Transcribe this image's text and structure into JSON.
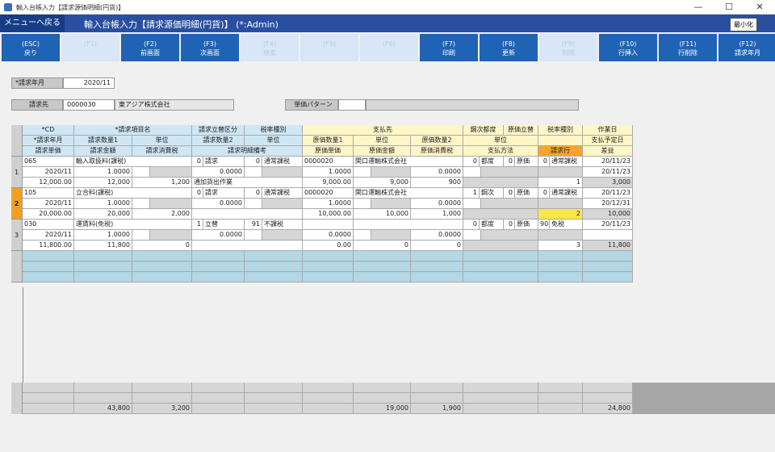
{
  "window": {
    "title": "輸入台帳入力【請求源価明細(円貨)】",
    "min": "—",
    "max": "☐",
    "close": "✕"
  },
  "header": {
    "back": "メニューへ戻る",
    "title": "輸入台帳入力【請求源価明細(円貨)】 (*:Admin)",
    "minimize": "最小化"
  },
  "fkeys": [
    {
      "key": "(ESC)",
      "label": "戻り",
      "enabled": true
    },
    {
      "key": "(F1)",
      "label": "",
      "enabled": false
    },
    {
      "key": "(F2)",
      "label": "前画面",
      "enabled": true
    },
    {
      "key": "(F3)",
      "label": "次画面",
      "enabled": true
    },
    {
      "key": "(F4)",
      "label": "検索",
      "enabled": false
    },
    {
      "key": "(F5)",
      "label": "",
      "enabled": false
    },
    {
      "key": "(F6)",
      "label": "",
      "enabled": false
    },
    {
      "key": "(F7)",
      "label": "印刷",
      "enabled": true
    },
    {
      "key": "(F8)",
      "label": "更新",
      "enabled": true
    },
    {
      "key": "(F9)",
      "label": "削除",
      "enabled": false
    },
    {
      "key": "(F10)",
      "label": "行挿入",
      "enabled": true
    },
    {
      "key": "(F11)",
      "label": "行削除",
      "enabled": true
    },
    {
      "key": "(F12)",
      "label": "請求年月",
      "enabled": true
    }
  ],
  "form": {
    "billing_month_label": "*請求年月",
    "billing_month": "2020/11",
    "customer_label": "請求先",
    "customer_code": "0000030",
    "customer_name": "東アジア株式会社",
    "price_pattern_label": "単価パターン",
    "price_pattern": ""
  },
  "grid_header": {
    "r1": [
      "*CD",
      "*請求項目名",
      "請求立替区分",
      "税率種別",
      "支払先",
      "鋼次都度",
      "原価立替",
      "税率種別",
      "作業日"
    ],
    "r2": [
      "*請求年月",
      "請求数量1",
      "単位",
      "請求数量2",
      "単位",
      "原価数量1",
      "単位",
      "原価数量2",
      "単位",
      "支払予定日"
    ],
    "r3": [
      "請求単価",
      "請求金額",
      "請求消費税",
      "請求明細備考",
      "原価単価",
      "原価金額",
      "原価消費税",
      "支払方法",
      "請求行",
      "差益"
    ]
  },
  "rows": [
    {
      "num": "1",
      "cd": "065",
      "item": "輸入取扱料(課税)",
      "rk": "0",
      "rk_t": "請求",
      "tax": "0",
      "tax_t": "通常課税",
      "payee": "0000020",
      "payee_name": "関口運輸株式会社",
      "tsudo": "0",
      "tsudo_t": "都度",
      "cost": "0",
      "cost_t": "原価",
      "tax2": "0",
      "tax2_t": "通常課税",
      "work": "20/11/23",
      "ym": "2020/11",
      "q1": "1.0000",
      "u1": "",
      "q2": "0.0000",
      "u2": "",
      "cq1": "1.0000",
      "cu1": "",
      "cq2": "0.0000",
      "cu2": "",
      "paydate": "20/11/23",
      "price": "12,000.00",
      "amount": "12,000",
      "ctax": "1,200",
      "memo": "通加貨出作業",
      "cprice": "9,000.00",
      "camount": "9,000",
      "cctax": "900",
      "paymethod": "",
      "line": "1",
      "profit": "3,000"
    },
    {
      "num": "2",
      "cd": "105",
      "item": "立合料(課税)",
      "rk": "0",
      "rk_t": "請求",
      "tax": "0",
      "tax_t": "通常課税",
      "payee": "0000020",
      "payee_name": "関口運輸株式会社",
      "tsudo": "1",
      "tsudo_t": "鋼次",
      "cost": "0",
      "cost_t": "原価",
      "tax2": "0",
      "tax2_t": "通常課税",
      "work": "20/11/23",
      "ym": "2020/11",
      "q1": "1.0000",
      "u1": "",
      "q2": "0.0000",
      "u2": "",
      "cq1": "1.0000",
      "cu1": "",
      "cq2": "0.0000",
      "cu2": "",
      "paydate": "20/12/31",
      "price": "20,000.00",
      "amount": "20,000",
      "ctax": "2,000",
      "memo": "",
      "cprice": "10,000.00",
      "camount": "10,000",
      "cctax": "1,000",
      "paymethod": "",
      "line": "2",
      "profit": "10,000"
    },
    {
      "num": "3",
      "cd": "030",
      "item": "運賃料(免税)",
      "rk": "1",
      "rk_t": "立替",
      "tax": "91",
      "tax_t": "不課税",
      "payee": "",
      "payee_name": "",
      "tsudo": "0",
      "tsudo_t": "都度",
      "cost": "0",
      "cost_t": "原価",
      "tax2": "90",
      "tax2_t": "免税",
      "work": "20/11/23",
      "ym": "2020/11",
      "q1": "1.0000",
      "u1": "",
      "q2": "0.0000",
      "u2": "",
      "cq1": "0.0000",
      "cu1": "",
      "cq2": "0.0000",
      "cu2": "",
      "paydate": "",
      "price": "11,800.00",
      "amount": "11,800",
      "ctax": "0",
      "memo": "",
      "cprice": "0.00",
      "camount": "0",
      "cctax": "0",
      "paymethod": "",
      "line": "3",
      "profit": "11,800"
    }
  ],
  "totals": {
    "amount": "43,800",
    "ctax": "3,200",
    "camount": "19,000",
    "cctax": "1,900",
    "profit": "24,800"
  }
}
